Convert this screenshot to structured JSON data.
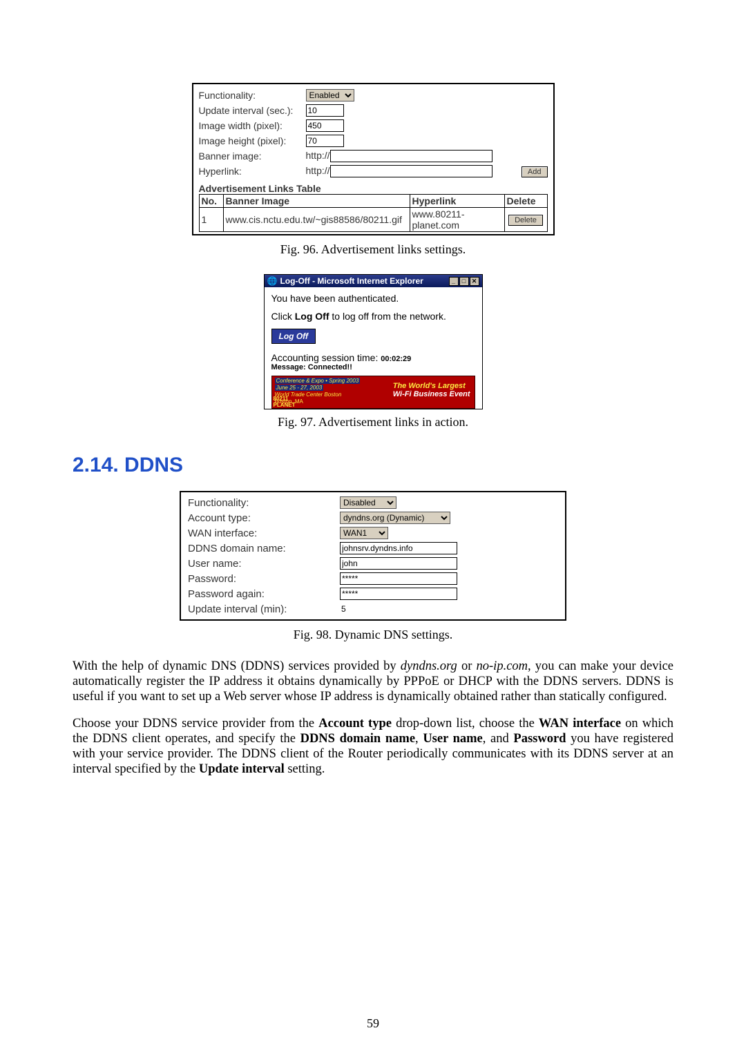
{
  "fig96": {
    "rows": {
      "functionality": {
        "label": "Functionality:",
        "value": "Enabled"
      },
      "update_interval": {
        "label": "Update interval (sec.):",
        "value": "10"
      },
      "image_width": {
        "label": "Image width (pixel):",
        "value": "450"
      },
      "image_height": {
        "label": "Image height (pixel):",
        "value": "70"
      },
      "banner": {
        "label": "Banner image:",
        "prefix": "http://",
        "value": ""
      },
      "hyperlink": {
        "label": "Hyperlink:",
        "prefix": "http://",
        "value": ""
      }
    },
    "add_btn": "Add",
    "adv_title": "Advertisement Links Table",
    "adv_headers": {
      "no": "No.",
      "banner": "Banner Image",
      "hyper": "Hyperlink",
      "delete": "Delete"
    },
    "adv_row": {
      "no": "1",
      "banner": "www.cis.nctu.edu.tw/~gis88586/80211.gif",
      "hyper": "www.80211-planet.com",
      "delete_btn": "Delete"
    },
    "caption": "Fig. 96. Advertisement links settings."
  },
  "fig97": {
    "title": "Log-Off - Microsoft Internet Explorer",
    "line1": "You have been authenticated.",
    "line2_a": "Click ",
    "line2_b": "Log Off",
    "line2_c": " to log off from the network.",
    "logoff_btn": "Log Off",
    "session_label": "Accounting session time: ",
    "session_time": "00:02:29",
    "message": "Message: Connected!!",
    "banner": {
      "conf": "Conference & Expo • Spring 2003",
      "dates": "June 25 - 27, 2003",
      "place": "World Trade Center Boston",
      "city": "Boston, MA",
      "logo1": "80211",
      "logo2": "PLANET",
      "r1": "The World's Largest",
      "r2": "Wi-Fi Business Event"
    },
    "caption": "Fig. 97. Advertisement links in action."
  },
  "section_heading": "2.14. DDNS",
  "fig98": {
    "rows": {
      "functionality": {
        "label": "Functionality:",
        "value": "Disabled"
      },
      "account": {
        "label": "Account type:",
        "value": "dyndns.org (Dynamic)"
      },
      "wan": {
        "label": "WAN interface:",
        "value": "WAN1"
      },
      "domain": {
        "label": "DDNS domain name:",
        "value": "johnsrv.dyndns.info"
      },
      "user": {
        "label": "User name:",
        "value": "john"
      },
      "pass": {
        "label": "Password:",
        "value": "*****"
      },
      "pass2": {
        "label": "Password again:",
        "value": "*****"
      },
      "interval": {
        "label": "Update interval (min):",
        "value": "5"
      }
    },
    "caption": "Fig. 98. Dynamic DNS settings."
  },
  "para1_a": "With the help of dynamic DNS (DDNS) services provided by ",
  "para1_b": "dyndns.org",
  "para1_c": " or ",
  "para1_d": "no-ip.com",
  "para1_e": ", you can make your device automatically register the IP address it obtains dynamically by PPPoE or DHCP with the DDNS servers. DDNS is useful if you want to set up a Web server whose IP address is dynamically obtained rather than statically configured.",
  "para2_a": "Choose your DDNS service provider from the ",
  "para2_b": "Account type",
  "para2_c": " drop-down list, choose the ",
  "para2_d": "WAN interface",
  "para2_e": " on which the DDNS client operates, and specify the ",
  "para2_f": "DDNS domain name",
  "para2_g": ", ",
  "para2_h": "User name",
  "para2_i": ", and ",
  "para2_j": "Password",
  "para2_k": " you have registered with your service provider. The DDNS client of the Router periodically communicates with its DDNS server at an interval specified by the ",
  "para2_l": "Update interval",
  "para2_m": " setting.",
  "page_number": "59"
}
